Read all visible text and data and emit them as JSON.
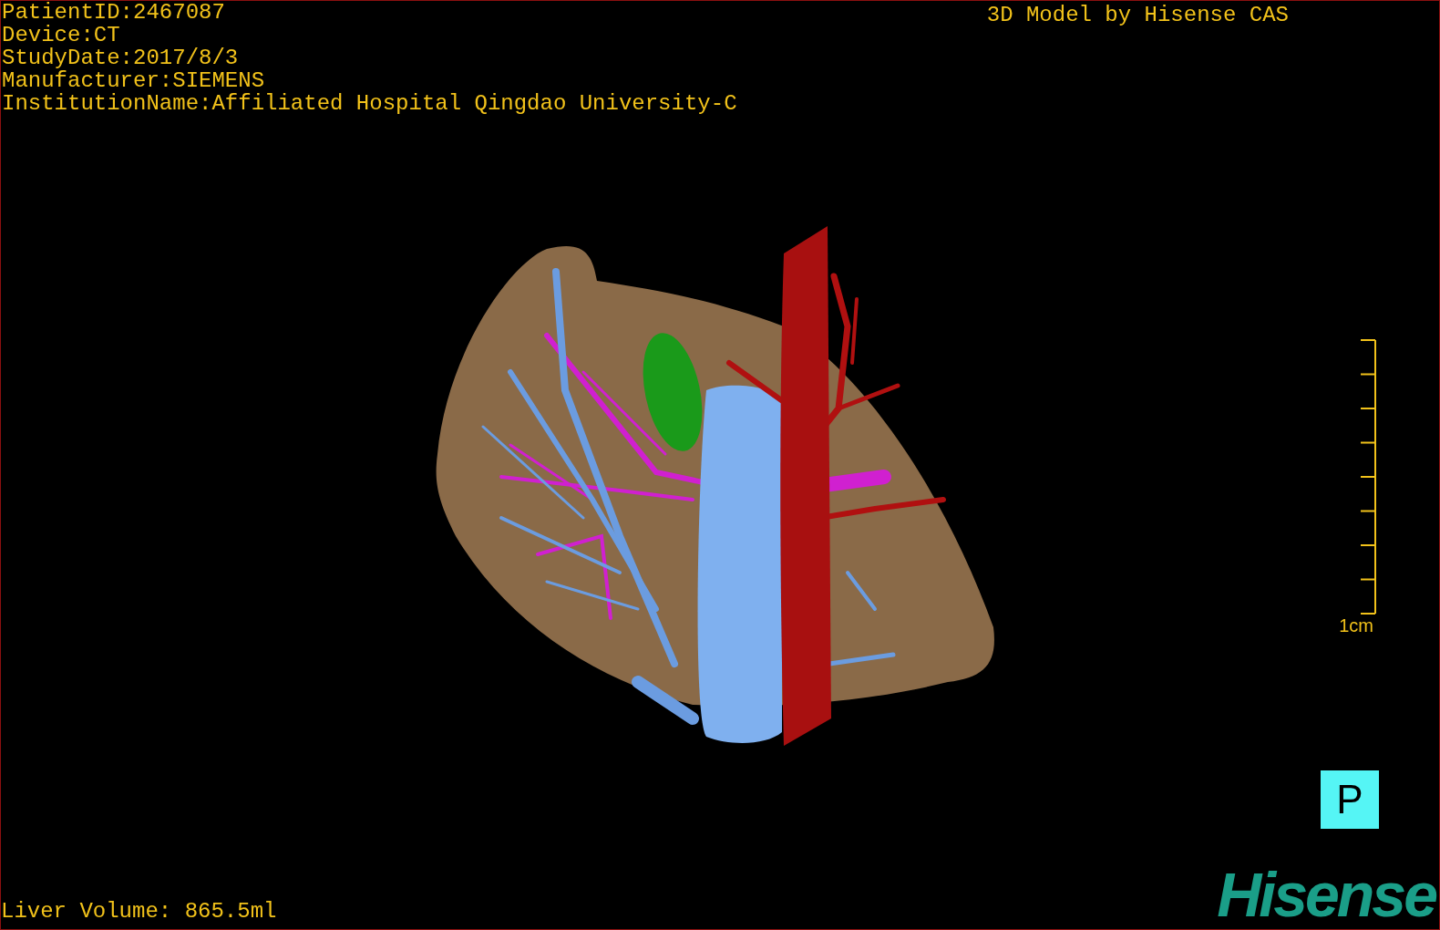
{
  "info_lines": [
    "PatientID:2467087",
    "Device:CT",
    "StudyDate:2017/8/3",
    "Manufacturer:SIEMENS",
    "InstitutionName:Affiliated Hospital Qingdao University-C"
  ],
  "model_title": "3D Model by Hisense CAS",
  "scale_bar": {
    "label": "1cm"
  },
  "orientation_button": {
    "label": "P"
  },
  "liver_volume": "Liver Volume: 865.5ml",
  "logo": "Hisense"
}
